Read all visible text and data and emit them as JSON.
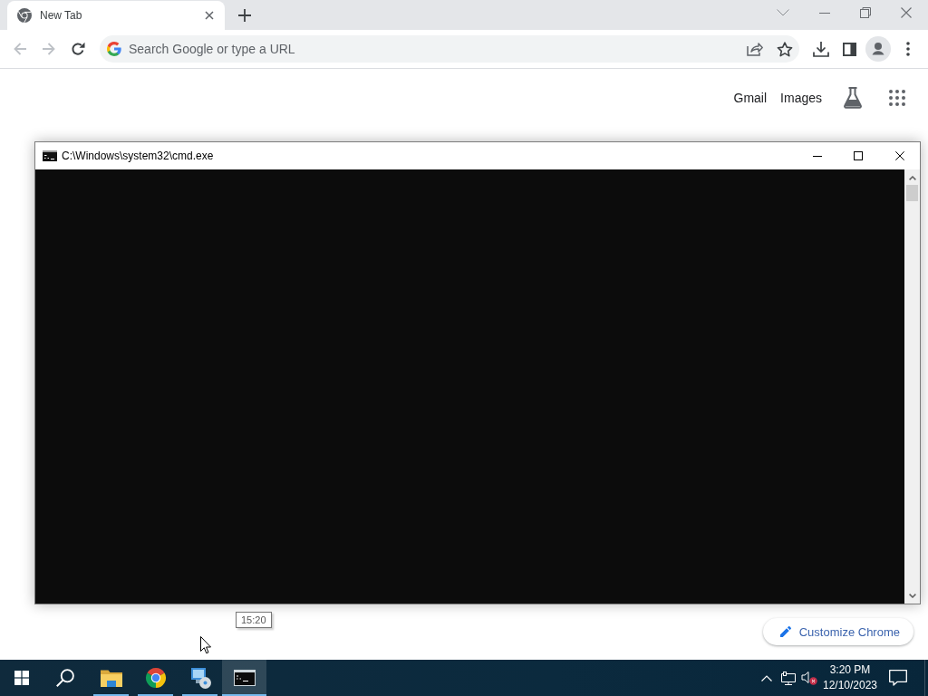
{
  "browser": {
    "tabs": [
      {
        "title": "New Tab",
        "selected": true
      }
    ],
    "nav_buttons": [
      {
        "kind": "back",
        "disabled": true
      },
      {
        "kind": "forward",
        "disabled": true
      },
      {
        "kind": "reload",
        "disabled": false
      }
    ],
    "omnibox": {
      "placeholder": "Search Google or type a URL"
    }
  },
  "new_tab_page": {
    "links": [
      "Gmail",
      "Images"
    ],
    "customize_button": "Customize Chrome"
  },
  "console_window": {
    "title": "C:\\Windows\\system32\\cmd.exe"
  },
  "tooltip": "15:20",
  "taskbar": {
    "apps": [
      {
        "kind": "start",
        "running": false,
        "selected": false
      },
      {
        "kind": "search",
        "running": false,
        "selected": false
      },
      {
        "kind": "folder",
        "running": true,
        "selected": false
      },
      {
        "kind": "browser",
        "running": true,
        "selected": false
      },
      {
        "kind": "network",
        "running": true,
        "selected": false
      },
      {
        "kind": "console",
        "running": true,
        "selected": true
      }
    ],
    "tray": {
      "volume_muted": true,
      "time": "3:20 PM",
      "date": "12/10/2023"
    }
  }
}
